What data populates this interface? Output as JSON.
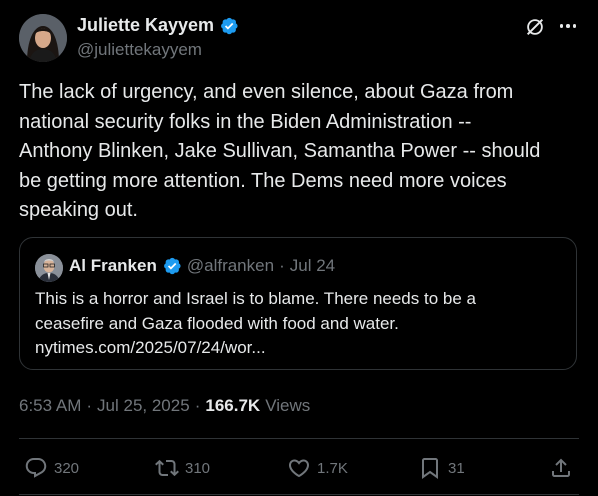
{
  "author": {
    "name": "Juliette Kayyem",
    "handle": "@juliettekayyem",
    "verified_color": "#1d9bf0"
  },
  "tweet": {
    "lines": [
      "The lack of urgency, and even silence, about Gaza from",
      "national security folks in the Biden Administration --",
      "Anthony Blinken, Jake Sullivan, Samantha Power -- should",
      "be getting more attention.  The Dems need more voices",
      "speaking out."
    ]
  },
  "quote": {
    "name": "Al Franken",
    "handle": "@alfranken",
    "separator": "·",
    "date": "Jul 24",
    "lines": [
      "This is a horror and Israel is to blame. There needs to be a",
      "ceasefire and Gaza flooded with food and water.",
      "nytimes.com/2025/07/24/wor..."
    ]
  },
  "meta": {
    "time": "6:53 AM",
    "sep1": "·",
    "date": "Jul 25, 2025",
    "sep2": "·",
    "views_count": "166.7K",
    "views_label": "Views"
  },
  "actions": {
    "replies": "320",
    "reposts": "310",
    "likes": "1.7K",
    "bookmarks": "31"
  },
  "icons": {
    "grok": "grok-icon",
    "more": "more-icon",
    "reply": "reply-icon",
    "repost": "repost-icon",
    "like": "heart-icon",
    "bookmark": "bookmark-icon",
    "share": "share-icon"
  },
  "colors": {
    "background": "#000000",
    "text": "#e7e9ea",
    "secondary": "#71767b",
    "border": "#2f3336",
    "accent": "#1d9bf0"
  }
}
